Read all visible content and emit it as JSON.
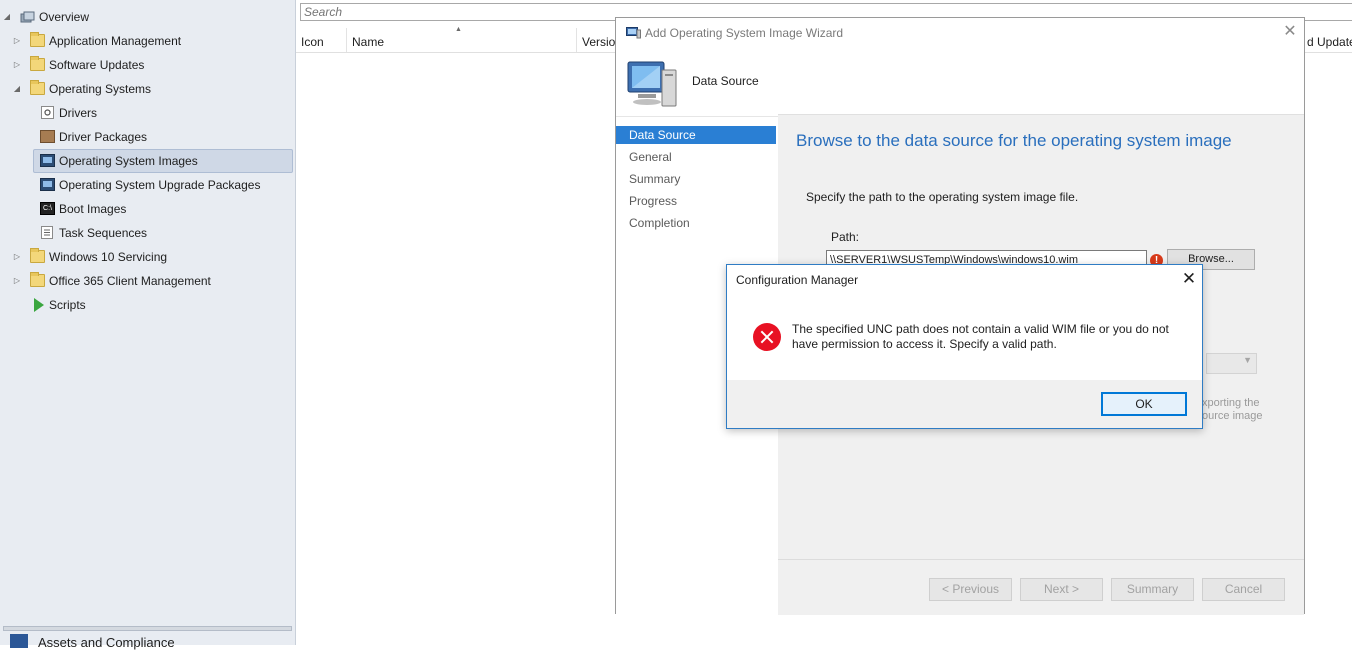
{
  "navigation": {
    "items": [
      {
        "label": "Overview",
        "arrow": "◢",
        "icon": "overview-icon"
      },
      {
        "label": "Application Management",
        "arrow": "▷",
        "icon": "folder-icon"
      },
      {
        "label": "Software Updates",
        "arrow": "▷",
        "icon": "folder-icon"
      },
      {
        "label": "Operating Systems",
        "arrow": "◢",
        "icon": "folder-icon"
      },
      {
        "label": "Drivers",
        "arrow": "",
        "icon": "driver-icon"
      },
      {
        "label": "Driver Packages",
        "arrow": "",
        "icon": "package-icon"
      },
      {
        "label": "Operating System Images",
        "arrow": "",
        "icon": "monitor-icon",
        "selected": true
      },
      {
        "label": "Operating System Upgrade Packages",
        "arrow": "",
        "icon": "monitor-icon"
      },
      {
        "label": "Boot Images",
        "arrow": "",
        "icon": "boot-icon"
      },
      {
        "label": "Task Sequences",
        "arrow": "",
        "icon": "document-icon"
      },
      {
        "label": "Windows 10 Servicing",
        "arrow": "▷",
        "icon": "folder-icon"
      },
      {
        "label": "Office 365 Client Management",
        "arrow": "▷",
        "icon": "folder-icon"
      },
      {
        "label": "Scripts",
        "arrow": "",
        "icon": "play-icon"
      }
    ],
    "bottom_label": "Assets and Compliance"
  },
  "search": {
    "placeholder": "Search"
  },
  "list": {
    "columns": [
      "Icon",
      "Name",
      "Version",
      "d Update"
    ]
  },
  "wizard": {
    "title": "Add Operating System Image Wizard",
    "close_glyph": "✕",
    "page_header": "Data Source",
    "steps": [
      "Data Source",
      "General",
      "Summary",
      "Progress",
      "Completion"
    ],
    "active_step": 0,
    "heading": "Browse to the data source for the operating system image",
    "description": "Specify the path to the operating system image file.",
    "path_label": "Path:",
    "path_value": "\\\\SERVER1\\WSUSTemp\\Windows\\windows10.wim",
    "error_glyph": "!",
    "browse_label": "Browse...",
    "hint_line1": "xporting the",
    "hint_line2": "ource image",
    "buttons": {
      "previous": "< Previous",
      "next": "Next >",
      "summary": "Summary",
      "cancel": "Cancel"
    }
  },
  "message_box": {
    "title": "Configuration Manager",
    "close_glyph": "✕",
    "text": "The specified UNC path does not contain a valid WIM file or you do not have permission to access it. Specify a valid path.",
    "ok_label": "OK",
    "icon": "error-icon"
  },
  "colors": {
    "accent": "#2a7fd4",
    "heading_blue": "#2a6fbd",
    "error_red": "#e81123",
    "nav_background": "#e8ecf2"
  }
}
